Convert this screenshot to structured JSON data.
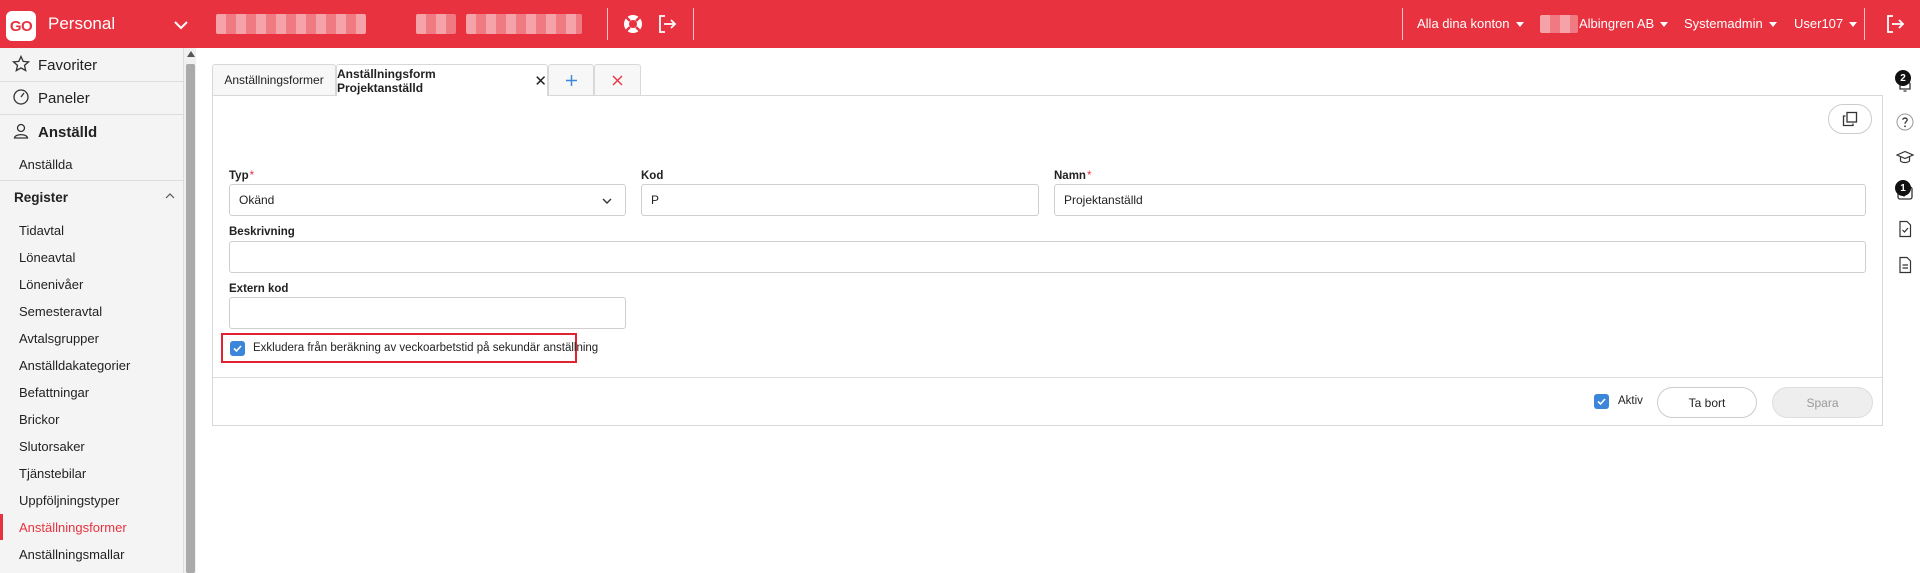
{
  "topbar": {
    "logo_text": "GO",
    "app_title": "Personal",
    "accounts_menu": "Alla dina konton",
    "company_menu": "Albingren AB",
    "role_menu": "Systemadmin",
    "user_menu": "User107",
    "accent_color": "#e8323f"
  },
  "sidebar": {
    "favorites": "Favoriter",
    "panels": "Paneler",
    "section": "Anställd",
    "employees": "Anställda",
    "register": "Register",
    "items": [
      {
        "label": "Tidavtal"
      },
      {
        "label": "Löneavtal"
      },
      {
        "label": "Lönenivåer"
      },
      {
        "label": "Semesteravtal"
      },
      {
        "label": "Avtalsgrupper"
      },
      {
        "label": "Anställdakategorier"
      },
      {
        "label": "Befattningar"
      },
      {
        "label": "Brickor"
      },
      {
        "label": "Slutorsaker"
      },
      {
        "label": "Tjänstebilar"
      },
      {
        "label": "Uppföljningstyper"
      },
      {
        "label": "Anställningsformer"
      },
      {
        "label": "Anställningsmallar"
      }
    ]
  },
  "tabs": [
    {
      "label": "Anställningsformer"
    },
    {
      "label": "Anställningsform Projektanställd"
    }
  ],
  "form": {
    "type_label": "Typ",
    "type_value": "Okänd",
    "code_label": "Kod",
    "code_value": "P",
    "name_label": "Namn",
    "name_value": "Projektanställd",
    "description_label": "Beskrivning",
    "description_value": "",
    "external_code_label": "Extern kod",
    "external_code_value": "",
    "required_marker": "*",
    "exclude_checkbox_label": "Exkludera från beräkning av veckoarbetstid på sekundär anställning",
    "exclude_checked": true
  },
  "footer": {
    "active_label": "Aktiv",
    "active_checked": true,
    "delete_button": "Ta bort",
    "save_button": "Spara"
  },
  "rail": {
    "notifications_count": "2",
    "tasks_count": "1"
  }
}
